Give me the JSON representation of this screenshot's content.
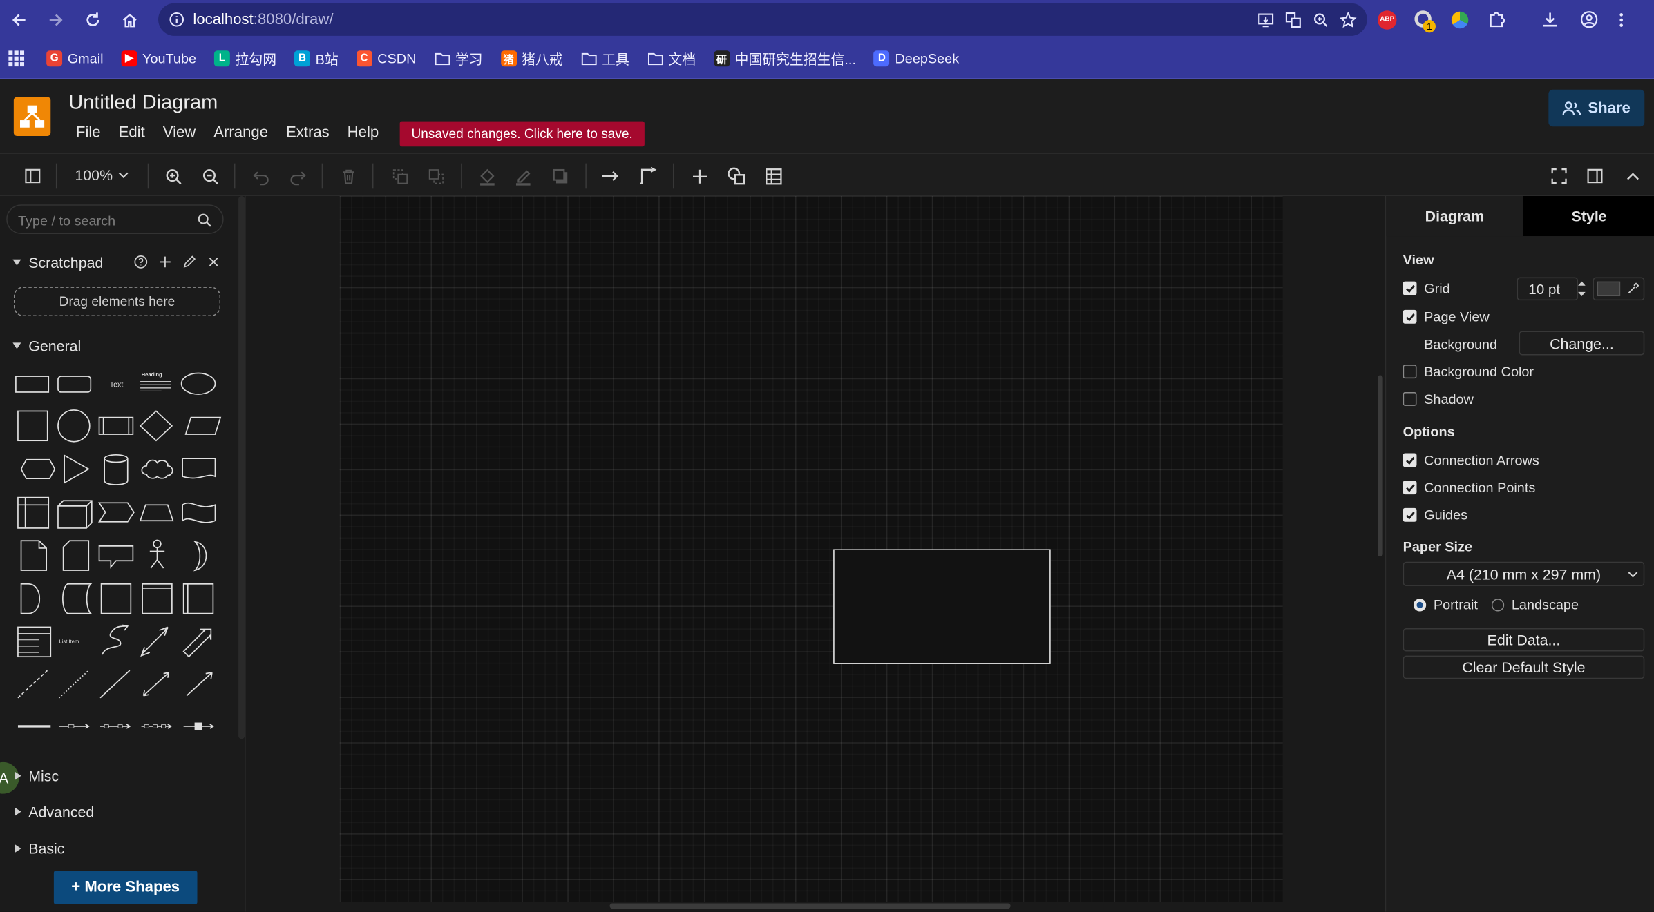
{
  "browser": {
    "url_host": "localhost",
    "url_path": ":8080/draw/",
    "bookmarks": [
      {
        "label": "Gmail",
        "color": "#ea4335",
        "glyph": "G"
      },
      {
        "label": "YouTube",
        "color": "#ff0000",
        "glyph": "▶"
      },
      {
        "label": "拉勾网",
        "color": "#00b38a",
        "glyph": "L"
      },
      {
        "label": "B站",
        "color": "#00a1d6",
        "glyph": "B"
      },
      {
        "label": "CSDN",
        "color": "#fc5531",
        "glyph": "C"
      },
      {
        "label": "学习",
        "color": "",
        "glyph": "folder"
      },
      {
        "label": "猪八戒",
        "color": "#ff6a00",
        "glyph": "猪"
      },
      {
        "label": "工具",
        "color": "",
        "glyph": "folder"
      },
      {
        "label": "文档",
        "color": "",
        "glyph": "folder"
      },
      {
        "label": "中国研究生招生信...",
        "color": "#222222",
        "glyph": "研"
      },
      {
        "label": "DeepSeek",
        "color": "#4d6bfe",
        "glyph": "D"
      }
    ],
    "ext_badge": "1",
    "abp_label": "ABP"
  },
  "app": {
    "title": "Untitled Diagram",
    "menu": [
      "File",
      "Edit",
      "View",
      "Arrange",
      "Extras",
      "Help"
    ],
    "unsaved": "Unsaved changes. Click here to save.",
    "share": "Share",
    "zoom": "100%"
  },
  "sidebar": {
    "search_placeholder": "Type / to search",
    "scratchpad": "Scratchpad",
    "dropzone": "Drag elements here",
    "general": "General",
    "shape_text": "Text",
    "shape_heading": "Heading",
    "shape_list_item": "List Item",
    "sections": [
      "Misc",
      "Advanced",
      "Basic"
    ],
    "more_shapes": "+ More Shapes",
    "avatar_letter": "A"
  },
  "panel": {
    "tab_diagram": "Diagram",
    "tab_style": "Style",
    "view_heading": "View",
    "grid": "Grid",
    "grid_size": "10 pt",
    "page_view": "Page View",
    "background": "Background",
    "change": "Change...",
    "background_color": "Background Color",
    "shadow": "Shadow",
    "options_heading": "Options",
    "connection_arrows": "Connection Arrows",
    "connection_points": "Connection Points",
    "guides": "Guides",
    "paper_heading": "Paper Size",
    "paper_size": "A4 (210 mm x 297 mm)",
    "portrait": "Portrait",
    "landscape": "Landscape",
    "edit_data": "Edit Data...",
    "clear_style": "Clear Default Style"
  }
}
